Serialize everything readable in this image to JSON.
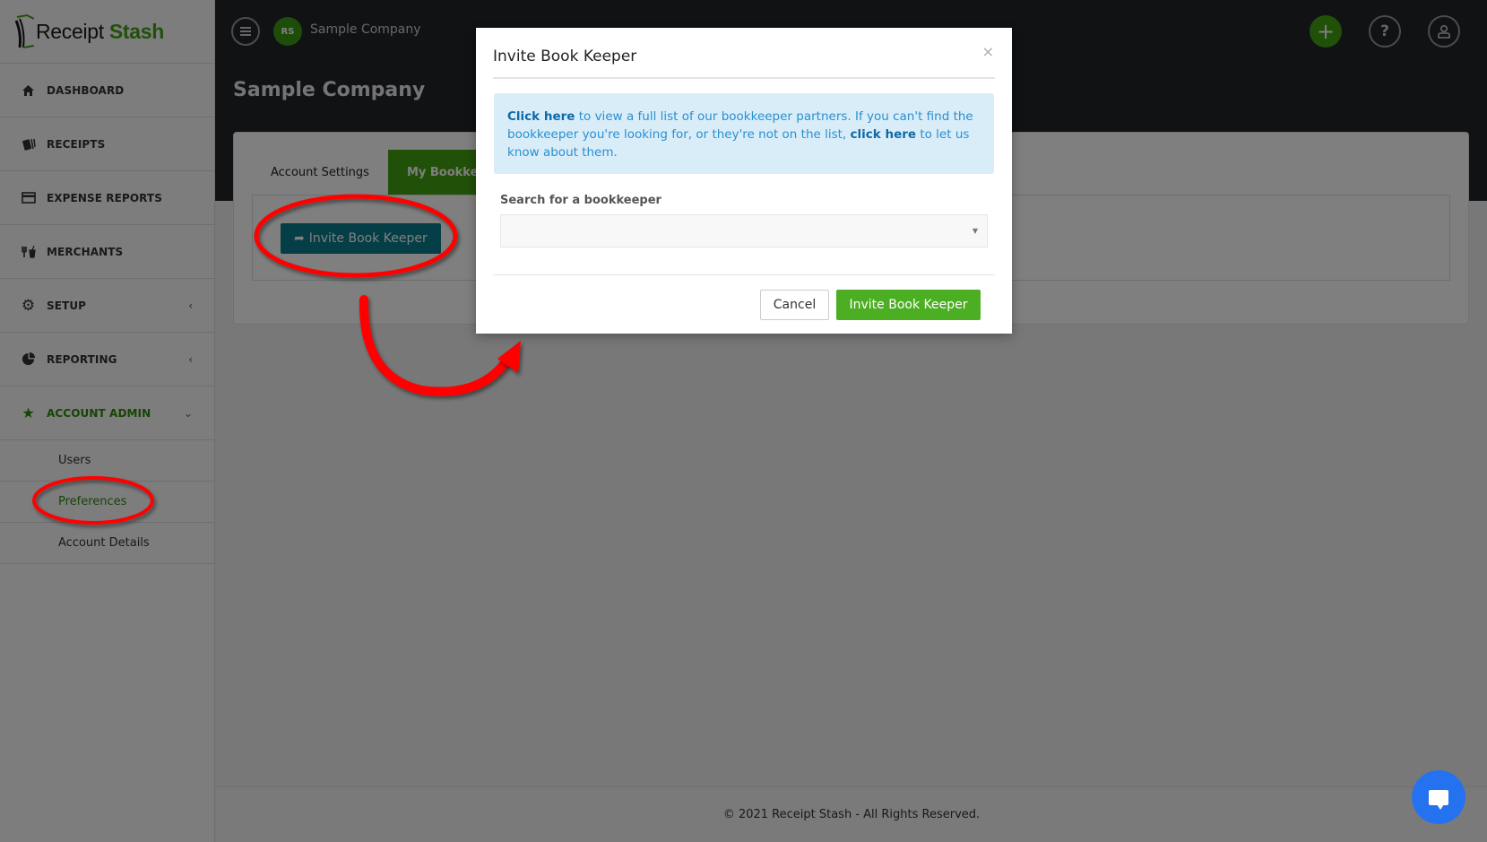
{
  "brand": {
    "name_part1": "Receipt",
    "name_part2": "Stash"
  },
  "sidebar": {
    "items": [
      {
        "label": "DASHBOARD",
        "icon": "home-icon"
      },
      {
        "label": "RECEIPTS",
        "icon": "receipts-icon"
      },
      {
        "label": "EXPENSE REPORTS",
        "icon": "credit-card-icon"
      },
      {
        "label": "MERCHANTS",
        "icon": "cutlery-icon"
      },
      {
        "label": "SETUP",
        "icon": "gear-icon",
        "caret": "‹"
      },
      {
        "label": "REPORTING",
        "icon": "pie-chart-icon",
        "caret": "‹"
      },
      {
        "label": "ACCOUNT ADMIN",
        "icon": "star-icon",
        "caret": "⌄"
      }
    ],
    "subitems": [
      {
        "label": "Users"
      },
      {
        "label": "Preferences"
      },
      {
        "label": "Account Details"
      }
    ]
  },
  "topbar": {
    "company_badge": "RS",
    "company_name": "Sample Company",
    "plus_glyph": "+",
    "help_glyph": "?",
    "user_glyph": "👤"
  },
  "page": {
    "title": "Sample Company",
    "tabs": [
      {
        "label": "Account Settings"
      },
      {
        "label": "My Bookkeep"
      }
    ],
    "invite_button": "Invite Book Keeper",
    "invite_icon_glyph": "➦"
  },
  "modal": {
    "title": "Invite Book Keeper",
    "close_glyph": "×",
    "alert": {
      "link1": "Click here",
      "text1": " to view a full list of our bookkeeper partners. If you can't find the bookkeeper you're looking for, or they're not on the list, ",
      "link2": "click here",
      "text2": " to let us know about them."
    },
    "search_label": "Search for a bookkeeper",
    "search_value": "",
    "caret_glyph": "▼",
    "cancel_label": "Cancel",
    "invite_label": "Invite Book Keeper"
  },
  "footer": {
    "text": "© 2021 Receipt Stash - All Rights Reserved."
  },
  "colors": {
    "brand_green": "#43a012",
    "teal": "#0b7d8c",
    "annotation_red": "#ff0000",
    "chat_blue": "#2572f0"
  }
}
